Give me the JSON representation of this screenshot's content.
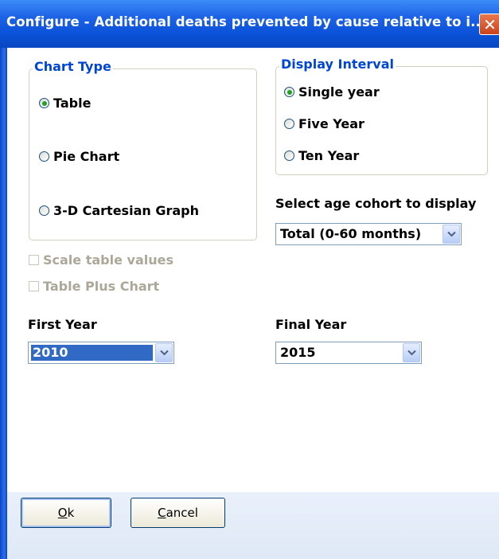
{
  "window": {
    "title": "Configure - Additional deaths prevented by cause relative to i...",
    "close_glyph": "✕"
  },
  "chart_type": {
    "title": "Chart Type",
    "options": [
      {
        "label": "Table",
        "checked": true
      },
      {
        "label": "Pie Chart",
        "checked": false
      },
      {
        "label": "3-D Cartesian Graph",
        "checked": false
      }
    ]
  },
  "display_interval": {
    "title": "Display Interval",
    "options": [
      {
        "label": "Single year",
        "checked": true
      },
      {
        "label": "Five Year",
        "checked": false
      },
      {
        "label": "Ten Year",
        "checked": false
      }
    ]
  },
  "age_cohort": {
    "label": "Select age cohort to display",
    "value": "Total (0-60 months)"
  },
  "checkboxes": {
    "scale_table_values": {
      "label": "Scale table values",
      "checked": false,
      "enabled": false
    },
    "table_plus_chart": {
      "label": "Table Plus Chart",
      "checked": false,
      "enabled": false
    }
  },
  "first_year": {
    "label": "First Year",
    "value": "2010"
  },
  "final_year": {
    "label": "Final Year",
    "value": "2015"
  },
  "buttons": {
    "ok_mnemonic": "O",
    "ok_rest": "k",
    "cancel_mnemonic": "C",
    "cancel_rest": "ancel"
  },
  "colors": {
    "titlebar": "#0a52d8",
    "group_title": "#0046d5",
    "selection": "#316ac5"
  }
}
